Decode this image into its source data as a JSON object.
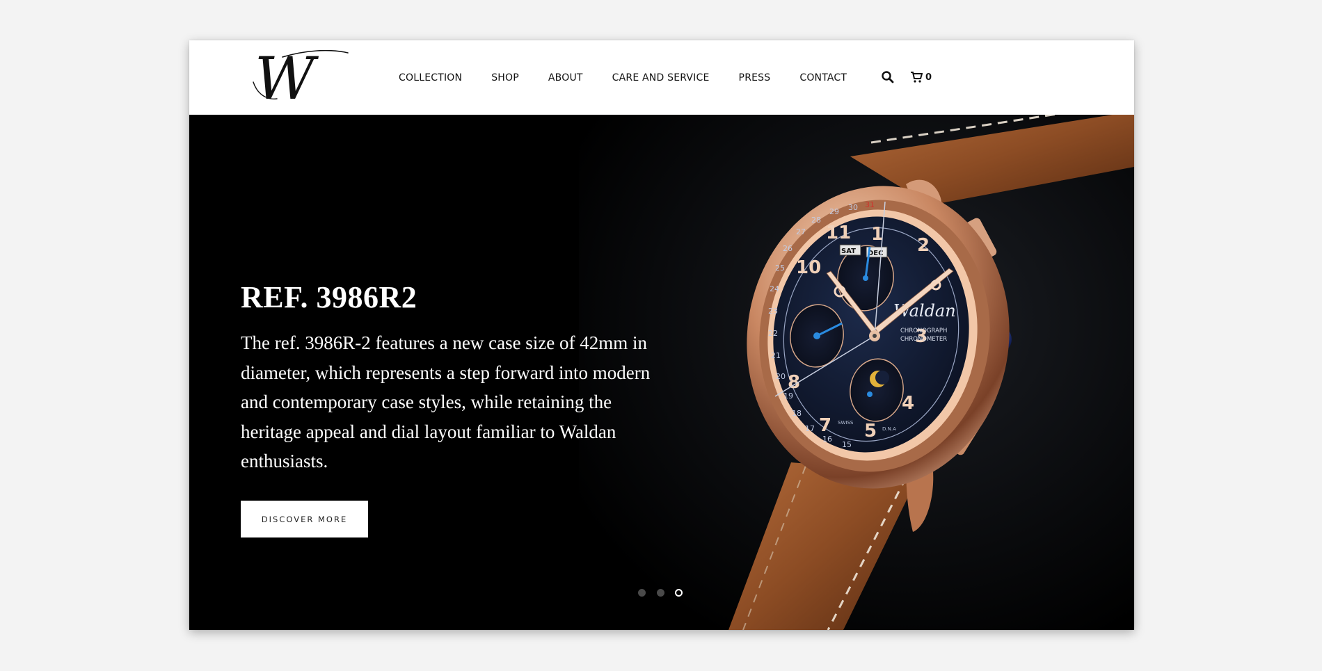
{
  "brand": {
    "logo_letter": "W",
    "logo_style": "script-monogram"
  },
  "nav": {
    "items": [
      "COLLECTION",
      "SHOP",
      "ABOUT",
      "CARE AND SERVICE",
      "PRESS",
      "CONTACT"
    ],
    "search_icon": "search-icon",
    "cart_icon": "cart-icon",
    "cart_count": "0"
  },
  "hero": {
    "title": "REF. 3986R2",
    "description": "The ref. 3986R-2 features a new case size of 42mm in diameter, which represents a step forward into modern and contemporary case styles, while retaining the heritage appeal and dial layout familiar to Waldan enthusiasts.",
    "cta_label": "DISCOVER MORE",
    "slider": {
      "total_slides": 3,
      "active_slide": 3
    },
    "watch_dial": {
      "brand": "Waldan",
      "line1": "CHRONOGRAPH",
      "line2": "CHRONOMETER",
      "swiss": "SWISS",
      "dna": "D.N.A",
      "day": "SAT",
      "month": "DEC"
    }
  },
  "colors": {
    "page_background": "#f3f3f3",
    "header_background": "#ffffff",
    "hero_background": "#000000",
    "rose_gold": "#d4906a",
    "strap_brown": "#8a4a22",
    "dial_navy": "#121a33",
    "accent_blue": "#1f7fd6"
  }
}
